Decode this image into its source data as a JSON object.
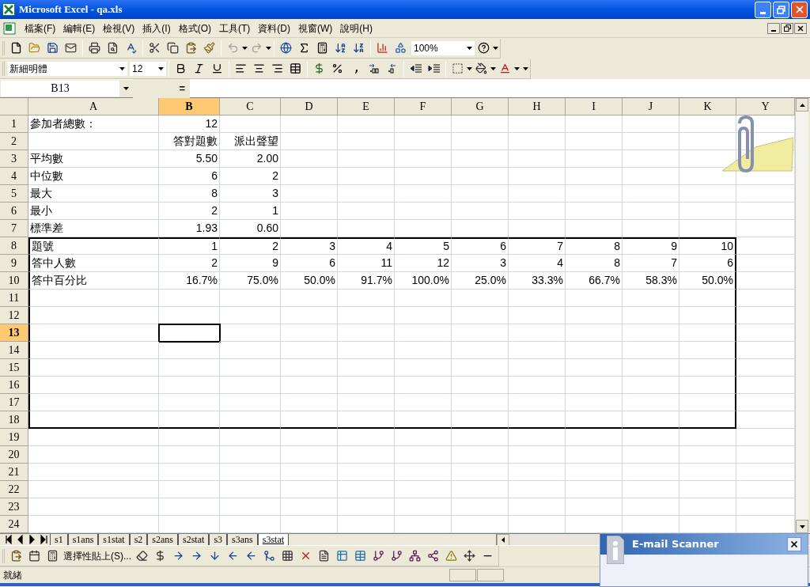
{
  "window": {
    "title": "Microsoft Excel - qa.xls"
  },
  "menu": [
    "檔案(F)",
    "編輯(E)",
    "檢視(V)",
    "插入(I)",
    "格式(O)",
    "工具(T)",
    "資料(D)",
    "視窗(W)",
    "說明(H)"
  ],
  "zoom": "100%",
  "formatting": {
    "font": "新細明體",
    "size": "12"
  },
  "name_box": "B13",
  "formula_sign": "=",
  "columns": [
    {
      "label": "A",
      "selected": false
    },
    {
      "label": "B",
      "selected": true
    },
    {
      "label": "C",
      "selected": false
    },
    {
      "label": "D",
      "selected": false
    },
    {
      "label": "E",
      "selected": false
    },
    {
      "label": "F",
      "selected": false
    },
    {
      "label": "G",
      "selected": false
    },
    {
      "label": "H",
      "selected": false
    },
    {
      "label": "I",
      "selected": false
    },
    {
      "label": "J",
      "selected": false
    },
    {
      "label": "K",
      "selected": false
    },
    {
      "label": "Y",
      "selected": false
    }
  ],
  "rows": [
    {
      "header": "1",
      "selected": false,
      "boxed": false,
      "cells": [
        "參加者總數：",
        "12"
      ]
    },
    {
      "header": "2",
      "selected": false,
      "boxed": false,
      "cells": [
        null,
        "答對題數",
        "派出聲望"
      ]
    },
    {
      "header": "3",
      "selected": false,
      "boxed": false,
      "cells": [
        "平均數",
        "5.50",
        "2.00"
      ]
    },
    {
      "header": "4",
      "selected": false,
      "boxed": false,
      "cells": [
        "中位數",
        "6",
        "2"
      ]
    },
    {
      "header": "5",
      "selected": false,
      "boxed": false,
      "cells": [
        "最大",
        "8",
        "3"
      ]
    },
    {
      "header": "6",
      "selected": false,
      "boxed": false,
      "cells": [
        "最小",
        "2",
        "1"
      ]
    },
    {
      "header": "7",
      "selected": false,
      "boxed": false,
      "cells": [
        "標準差",
        "1.93",
        "0.60"
      ]
    },
    {
      "header": "8",
      "selected": false,
      "boxed": true,
      "cells": [
        "題號",
        "1",
        "2",
        "3",
        "4",
        "5",
        "6",
        "7",
        "8",
        "9",
        "10"
      ]
    },
    {
      "header": "9",
      "selected": false,
      "boxed": true,
      "cells": [
        "答中人數",
        "2",
        "9",
        "6",
        "11",
        "12",
        "3",
        "4",
        "8",
        "7",
        "6"
      ]
    },
    {
      "header": "10",
      "selected": false,
      "boxed": true,
      "cells": [
        "答中百分比",
        "16.7%",
        "75.0%",
        "50.0%",
        "91.7%",
        "100.0%",
        "25.0%",
        "33.3%",
        "66.7%",
        "58.3%",
        "50.0%"
      ]
    },
    {
      "header": "11",
      "selected": false,
      "boxed": true
    },
    {
      "header": "12",
      "selected": false,
      "boxed": true
    },
    {
      "header": "13",
      "selected": true,
      "boxed": true
    },
    {
      "header": "14",
      "selected": false,
      "boxed": true
    },
    {
      "header": "15",
      "selected": false,
      "boxed": true
    },
    {
      "header": "16",
      "selected": false,
      "boxed": true
    },
    {
      "header": "17",
      "selected": false,
      "boxed": true
    },
    {
      "header": "18",
      "selected": false,
      "boxed": true
    },
    {
      "header": "19",
      "selected": false,
      "boxed": false
    },
    {
      "header": "20",
      "selected": false,
      "boxed": false
    },
    {
      "header": "21",
      "selected": false,
      "boxed": false
    },
    {
      "header": "22",
      "selected": false,
      "boxed": false
    },
    {
      "header": "23",
      "selected": false,
      "boxed": false
    },
    {
      "header": "24",
      "selected": false,
      "boxed": false
    }
  ],
  "sheet_tabs": [
    {
      "label": "s1",
      "selected": false
    },
    {
      "label": "s1ans",
      "selected": false
    },
    {
      "label": "s1stat",
      "selected": false
    },
    {
      "label": "s2",
      "selected": false
    },
    {
      "label": "s2ans",
      "selected": false
    },
    {
      "label": "s2stat",
      "selected": false
    },
    {
      "label": "s3",
      "selected": false
    },
    {
      "label": "s3ans",
      "selected": false
    },
    {
      "label": "s3stat",
      "selected": true
    }
  ],
  "drawing_toolbar": {
    "paste_special": "選擇性貼上(S)..."
  },
  "status": "就緒",
  "notification": {
    "title": "E-mail Scanner"
  }
}
